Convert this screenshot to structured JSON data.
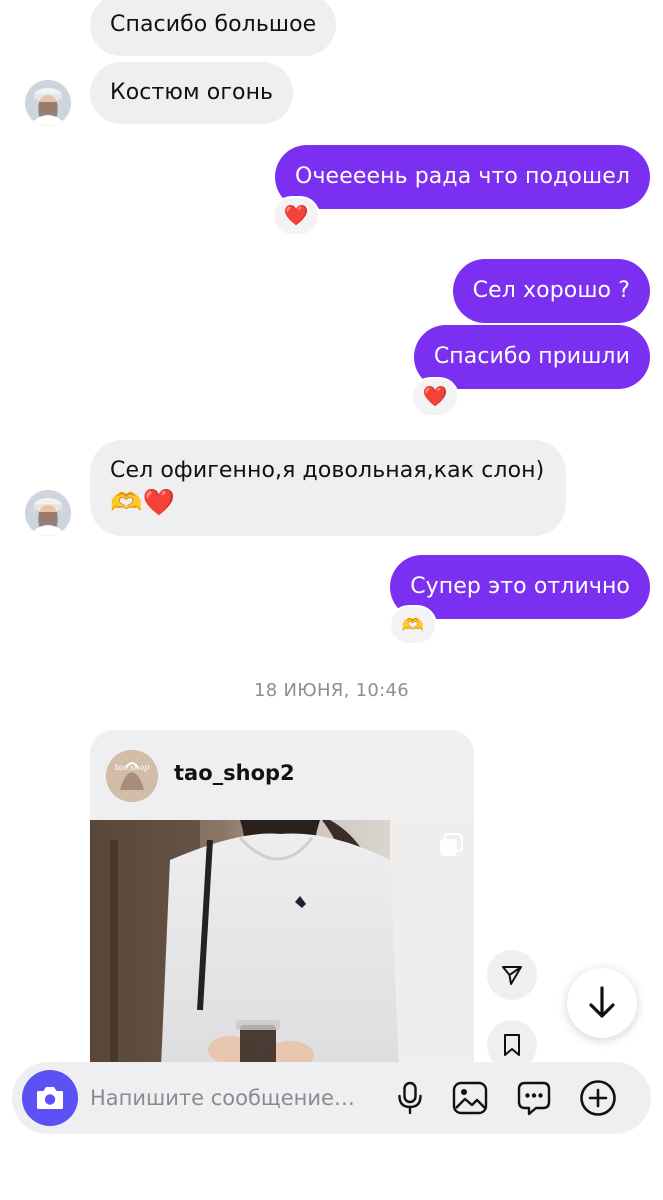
{
  "messages": [
    {
      "id": "m1",
      "side": "in",
      "text": "Спасибо большое"
    },
    {
      "id": "m2",
      "side": "in",
      "text": "Костюм огонь"
    },
    {
      "id": "m3",
      "side": "out",
      "text": "Очеееень рада что подошел",
      "reaction": "❤️"
    },
    {
      "id": "m4",
      "side": "out",
      "text": "Сел хорошо ?"
    },
    {
      "id": "m5",
      "side": "out",
      "text": "Спасибо пришли",
      "reaction": "❤️"
    },
    {
      "id": "m6",
      "side": "in",
      "text": "Сел офигенно,я довольная,как слон)",
      "emoji_line": "🫶❤️"
    },
    {
      "id": "m7",
      "side": "out",
      "text": "Супер это отлично",
      "reaction": "🫶"
    }
  ],
  "timestamp": "18 ИЮНЯ, 10:46",
  "shared_post": {
    "username": "tao_shop2",
    "avatar_text": "tao shop"
  },
  "composer": {
    "placeholder": "Напишите сообщение…"
  },
  "colors": {
    "outgoing_bubble": "#7b2ff0",
    "incoming_bubble": "#efeff2",
    "camera_button": "#5b51f5"
  },
  "icons": {
    "camera": "camera-icon",
    "mic": "microphone-icon",
    "gallery": "image-icon",
    "sticker": "chat-bubble-icon",
    "add": "plus-circle-icon",
    "share": "send-icon",
    "save": "bookmark-icon",
    "scroll": "arrow-down-icon",
    "carousel": "multiple-photos-icon"
  }
}
